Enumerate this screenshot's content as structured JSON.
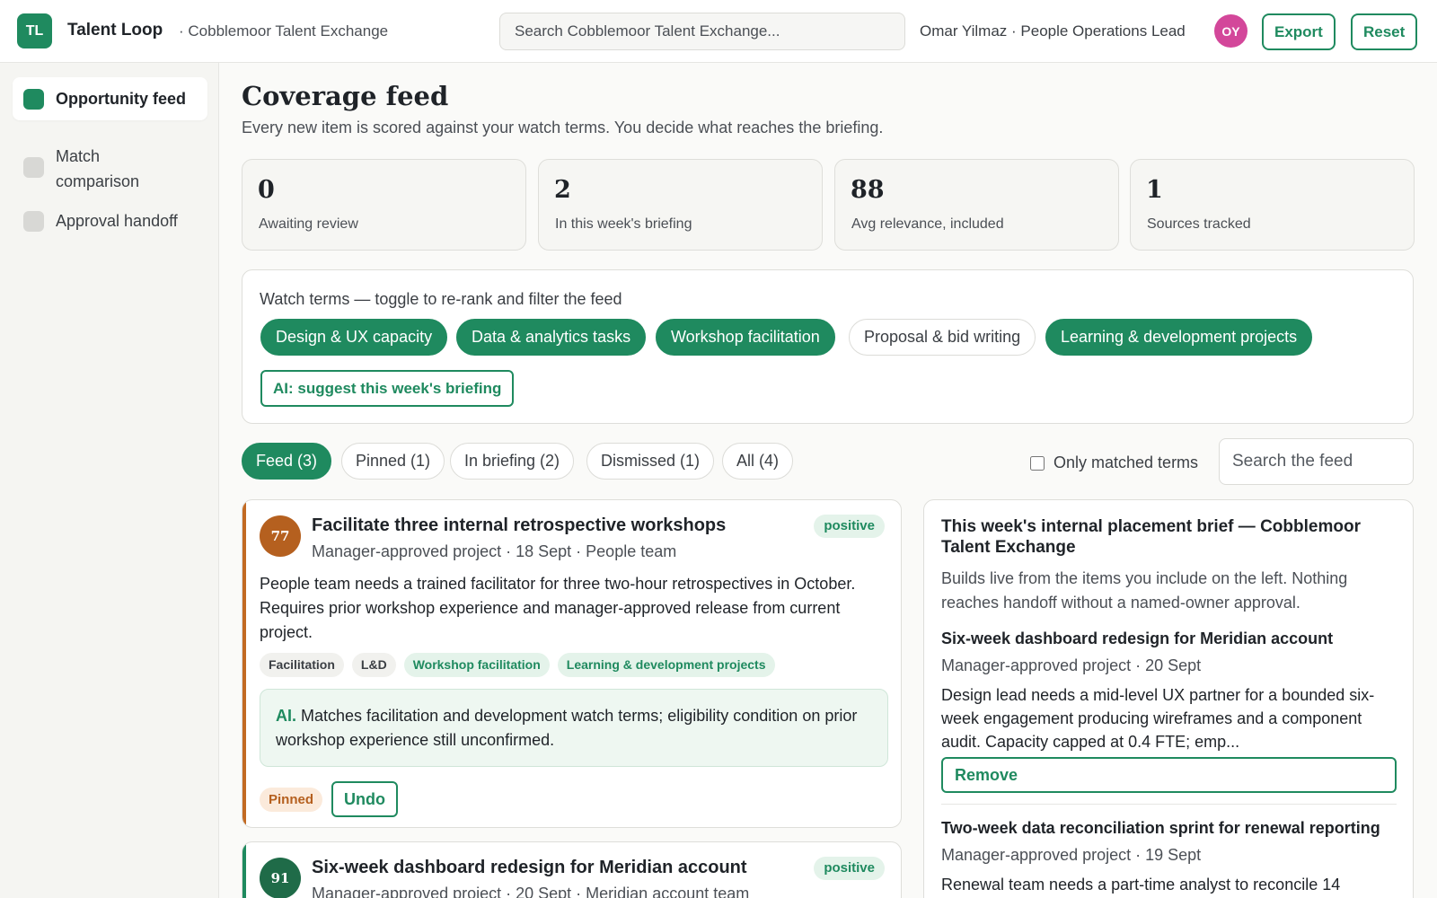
{
  "header": {
    "logo_initials": "TL",
    "app_name": "Talent Loop",
    "workspace": "· Cobblemoor Talent Exchange",
    "search_placeholder": "Search Cobblemoor Talent Exchange...",
    "user": "Omar Yilmaz · People Operations Lead",
    "avatar_initials": "OY",
    "export_label": "Export",
    "reset_label": "Reset"
  },
  "sidebar": {
    "items": [
      {
        "label": "Opportunity feed",
        "active": true
      },
      {
        "label": "Match comparison",
        "active": false
      },
      {
        "label": "Approval handoff",
        "active": false
      }
    ]
  },
  "main": {
    "title": "Coverage feed",
    "subtitle": "Every new item is scored against your watch terms. You decide what reaches the briefing.",
    "stats": [
      {
        "value": "0",
        "label": "Awaiting review"
      },
      {
        "value": "2",
        "label": "In this week's briefing"
      },
      {
        "value": "88",
        "label": "Avg relevance, included"
      },
      {
        "value": "1",
        "label": "Sources tracked"
      }
    ],
    "watch": {
      "title": "Watch terms — toggle to re-rank and filter the feed",
      "terms": [
        {
          "label": "Design & UX capacity",
          "on": true
        },
        {
          "label": "Data & analytics tasks",
          "on": true
        },
        {
          "label": "Workshop facilitation",
          "on": true
        },
        {
          "label": "Proposal & bid writing",
          "on": false
        },
        {
          "label": "Learning & development projects",
          "on": true
        }
      ],
      "ai_button": "AI: suggest this week's briefing"
    },
    "tabs": [
      {
        "label": "Feed (3)",
        "on": true
      },
      {
        "label": "Pinned (1)",
        "on": false
      },
      {
        "label": "In briefing (2)",
        "on": false
      },
      {
        "label": "Dismissed (1)",
        "on": false
      },
      {
        "label": "All (4)",
        "on": false
      }
    ],
    "only_matched_label": "Only matched terms",
    "feed_search_placeholder": "Search the feed"
  },
  "feed": [
    {
      "score": "77",
      "score_color": "#b5601f",
      "title": "Facilitate three internal retrospective workshops",
      "meta": "Manager-approved project · 18 Sept · People team",
      "sentiment": "positive",
      "body": "People team needs a trained facilitator for three two-hour retrospectives in October. Requires prior workshop experience and manager-approved release from current project.",
      "tags": [
        {
          "label": "Facilitation",
          "match": false
        },
        {
          "label": "L&D",
          "match": false
        },
        {
          "label": "Workshop facilitation",
          "match": true
        },
        {
          "label": "Learning & development projects",
          "match": true
        }
      ],
      "ai_prefix": "AI.",
      "ai_note": "Matches facilitation and development watch terms; eligibility condition on prior workshop experience still unconfirmed.",
      "status": "Pinned",
      "action": "Undo"
    },
    {
      "score": "91",
      "score_color": "#1f6b48",
      "title": "Six-week dashboard redesign for Meridian account",
      "meta": "Manager-approved project · 20 Sept · Meridian account team",
      "sentiment": "positive"
    }
  ],
  "brief": {
    "title": "This week's internal placement brief — Cobblemoor Talent Exchange",
    "description": "Builds live from the items you include on the left. Nothing reaches handoff without a named-owner approval.",
    "items": [
      {
        "title": "Six-week dashboard redesign for Meridian account",
        "meta": "Manager-approved project · 20 Sept",
        "body": "Design lead needs a mid-level UX partner for a bounded six-week engagement producing wireframes and a component audit. Capacity capped at 0.4 FTE; emp...",
        "action": "Remove"
      },
      {
        "title": "Two-week data reconciliation sprint for renewal reporting",
        "meta": "Manager-approved project · 19 Sept",
        "body": "Renewal team needs a part-time analyst to reconcile 14"
      }
    ]
  },
  "colors": {
    "accent": "#1f8a5f",
    "pinned_accent": "#c26a23"
  }
}
